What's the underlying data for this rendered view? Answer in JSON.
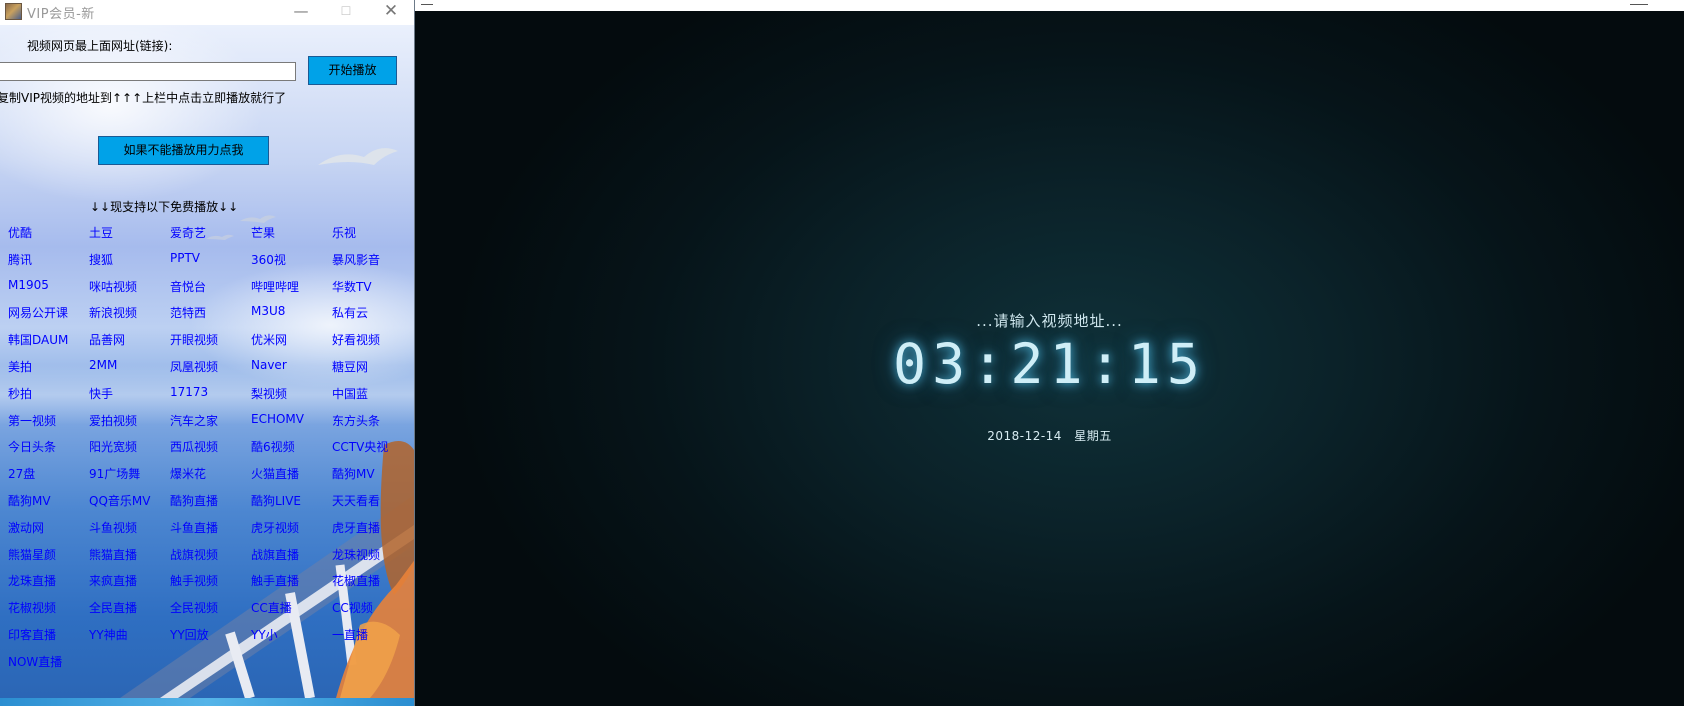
{
  "left_window": {
    "title": "VIP会员-新",
    "controls": {
      "minimize": "—",
      "maximize": "☐",
      "close": "✕"
    },
    "url_label": "视频网页最上面网址(链接):",
    "url_input_value": "",
    "play_button": "开始播放",
    "instruction": "复制VIP视频的地址到↑↑↑上栏中点击立即播放就行了",
    "help_button": "如果不能播放用力点我",
    "support_label": "↓↓现支持以下免费播放↓↓",
    "sites": [
      [
        "优酷",
        "土豆",
        "爱奇艺",
        "芒果",
        "乐视"
      ],
      [
        "腾讯",
        "搜狐",
        "PPTV",
        "360视",
        "暴风影音"
      ],
      [
        "M1905",
        "咪咕视频",
        "音悦台",
        "哔哩哔哩",
        "华数TV"
      ],
      [
        "网易公开课",
        "新浪视频",
        "范特西",
        "M3U8",
        "私有云"
      ],
      [
        "韩国DAUM",
        "品善网",
        "开眼视频",
        "优米网",
        "好看视频"
      ],
      [
        "美拍",
        "2MM",
        "凤凰视频",
        "Naver",
        "糖豆网"
      ],
      [
        "秒拍",
        "快手",
        "17173",
        "梨视频",
        "中国蓝"
      ],
      [
        "第一视频",
        "爱拍视频",
        "汽车之家",
        "ECHOMV",
        "东方头条"
      ],
      [
        "今日头条",
        "阳光宽频",
        "西瓜视频",
        "酷6视频",
        "CCTV央视"
      ],
      [
        "27盘",
        "91广场舞",
        "爆米花",
        "火猫直播",
        "酷狗MV"
      ],
      [
        "酷狗MV",
        "QQ音乐MV",
        "酷狗直播",
        "酷狗LIVE",
        "天天看看"
      ],
      [
        "激动网",
        "斗鱼视频",
        "斗鱼直播",
        "虎牙视频",
        "虎牙直播"
      ],
      [
        "熊猫星颜",
        "熊猫直播",
        "战旗视频",
        "战旗直播",
        "龙珠视频"
      ],
      [
        "龙珠直播",
        "来疯直播",
        "触手视频",
        "触手直播",
        "花椒直播"
      ],
      [
        "花椒视频",
        "全民直播",
        "全民视频",
        "CC直播",
        "CC视频"
      ],
      [
        "印客直播",
        "YY神曲",
        "YY回放",
        "YY小",
        "一直播"
      ],
      [
        "NOW直播"
      ]
    ]
  },
  "player_window": {
    "status": "...请输入视频地址...",
    "clock": "03:21:15",
    "date": "2018-12-14",
    "weekday": "星期五"
  },
  "colors": {
    "button_accent": "#00a2e8",
    "link_color": "#0000ff",
    "player_bg": "#0b2229",
    "clock_glow": "#5ad2ff"
  }
}
